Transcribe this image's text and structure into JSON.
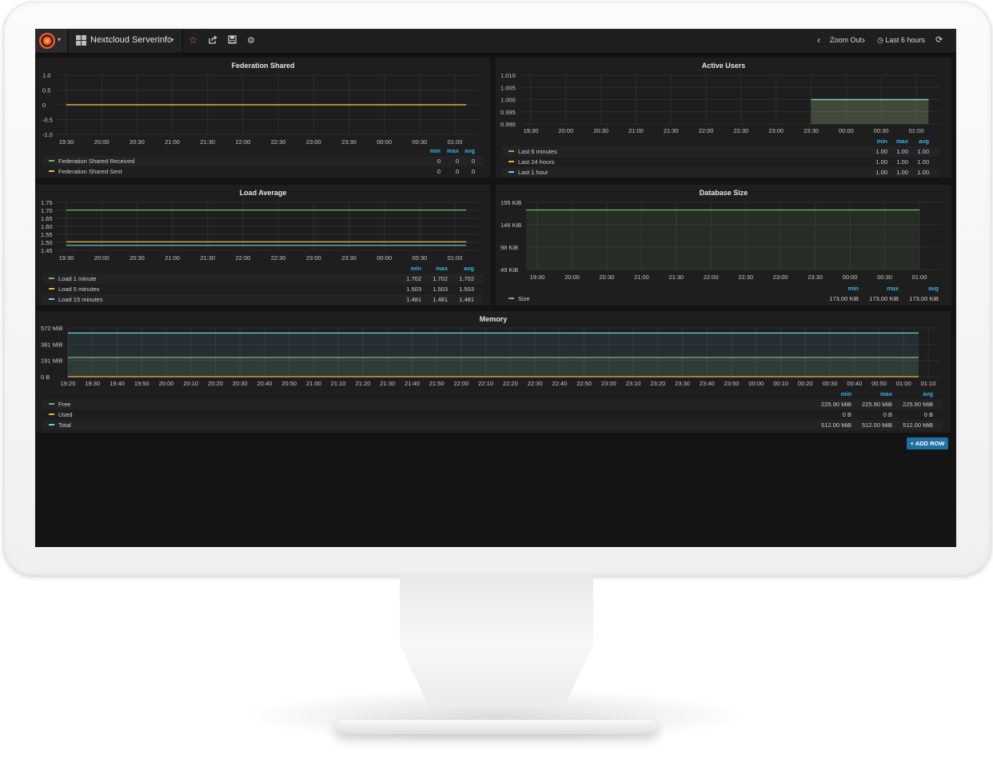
{
  "header": {
    "dashboard_title": "Nextcloud Serverinfo",
    "zoom_out": "Zoom Out",
    "time_range": "Last 6 hours",
    "icons": [
      "grafana-logo-icon",
      "dashboard-grid-icon",
      "star-icon",
      "share-icon",
      "save-icon",
      "gear-icon",
      "chevron-left-icon",
      "chevron-right-icon",
      "clock-icon",
      "refresh-icon"
    ]
  },
  "legend_columns": {
    "min": "min",
    "max": "max",
    "avg": "avg"
  },
  "add_row_label": "+ ADD ROW",
  "colors": {
    "green": "#7eb26d",
    "yellow": "#eab839",
    "cyan": "#6ed0e0",
    "accent": "#33b5e5",
    "button": "#1e6fa2"
  },
  "panels": {
    "federation": {
      "title": "Federation Shared",
      "series": [
        {
          "name": "Federation Shared Received",
          "min": "0",
          "max": "0",
          "avg": "0"
        },
        {
          "name": "Federation Shared Sent",
          "min": "0",
          "max": "0",
          "avg": "0"
        }
      ]
    },
    "active_users": {
      "title": "Active Users",
      "series": [
        {
          "name": "Last 5 minutes",
          "min": "1.00",
          "max": "1.00",
          "avg": "1.00"
        },
        {
          "name": "Last 24 hours",
          "min": "1.00",
          "max": "1.00",
          "avg": "1.00"
        },
        {
          "name": "Last 1 hour",
          "min": "1.00",
          "max": "1.00",
          "avg": "1.00"
        }
      ]
    },
    "load_average": {
      "title": "Load Average",
      "series": [
        {
          "name": "Load 1 minute",
          "min": "1.702",
          "max": "1.702",
          "avg": "1.702"
        },
        {
          "name": "Load 5 minutes",
          "min": "1.503",
          "max": "1.503",
          "avg": "1.503"
        },
        {
          "name": "Load 15 minutes",
          "min": "1.481",
          "max": "1.481",
          "avg": "1.481"
        }
      ]
    },
    "database_size": {
      "title": "Database Size",
      "series": [
        {
          "name": "Size",
          "min": "173.00 KiB",
          "max": "173.00 KiB",
          "avg": "173.00 KiB"
        }
      ]
    },
    "memory": {
      "title": "Memory",
      "series": [
        {
          "name": "Free",
          "min": "225.90 MiB",
          "max": "225.90 MiB",
          "avg": "225.90 MiB"
        },
        {
          "name": "Used",
          "min": "0 B",
          "max": "0 B",
          "avg": "0 B"
        },
        {
          "name": "Total",
          "min": "512.00 MiB",
          "max": "512.00 MiB",
          "avg": "512.00 MiB"
        }
      ]
    }
  },
  "chart_data": [
    {
      "id": "federation",
      "type": "line",
      "title": "Federation Shared",
      "x": [
        "19:30",
        "20:00",
        "20:30",
        "21:00",
        "21:30",
        "22:00",
        "22:30",
        "23:00",
        "23:30",
        "00:00",
        "00:30",
        "01:00"
      ],
      "yticks": [
        "1.0",
        "0.5",
        "0",
        "-0.5",
        "-1.0"
      ],
      "ylim": [
        -1.0,
        1.0
      ],
      "series": [
        {
          "name": "Federation Shared Received",
          "color": "#7eb26d",
          "values": [
            0,
            0,
            0,
            0,
            0,
            0,
            0,
            0,
            0,
            0,
            0,
            0
          ]
        },
        {
          "name": "Federation Shared Sent",
          "color": "#eab839",
          "values": [
            0,
            0,
            0,
            0,
            0,
            0,
            0,
            0,
            0,
            0,
            0,
            0
          ]
        }
      ]
    },
    {
      "id": "active_users",
      "type": "area",
      "title": "Active Users",
      "x": [
        "19:30",
        "20:00",
        "20:30",
        "21:00",
        "21:30",
        "22:00",
        "22:30",
        "23:00",
        "23:30",
        "00:00",
        "00:30",
        "01:00"
      ],
      "yticks": [
        "1.010",
        "1.005",
        "1.000",
        "0.995",
        "0.990"
      ],
      "ylim": [
        0.99,
        1.01
      ],
      "series": [
        {
          "name": "Last 5 minutes",
          "color": "#7eb26d",
          "x_range": [
            "23:30",
            "01:10"
          ],
          "value": 1.0
        },
        {
          "name": "Last 24 hours",
          "color": "#eab839",
          "x_range": [
            "23:30",
            "01:10"
          ],
          "value": 1.0
        },
        {
          "name": "Last 1 hour",
          "color": "#6ed0e0",
          "x_range": [
            "23:30",
            "01:10"
          ],
          "value": 1.0
        }
      ]
    },
    {
      "id": "load_average",
      "type": "line",
      "title": "Load Average",
      "x": [
        "19:30",
        "20:00",
        "20:30",
        "21:00",
        "21:30",
        "22:00",
        "22:30",
        "23:00",
        "23:30",
        "00:00",
        "00:30",
        "01:00"
      ],
      "yticks": [
        "1.75",
        "1.70",
        "1.65",
        "1.60",
        "1.55",
        "1.50",
        "1.45"
      ],
      "ylim": [
        1.45,
        1.75
      ],
      "series": [
        {
          "name": "Load 1 minute",
          "color": "#7eb26d",
          "value": 1.702
        },
        {
          "name": "Load 5 minutes",
          "color": "#eab839",
          "value": 1.503
        },
        {
          "name": "Load 15 minutes",
          "color": "#6ed0e0",
          "value": 1.481
        }
      ]
    },
    {
      "id": "database_size",
      "type": "area",
      "title": "Database Size",
      "x": [
        "19:30",
        "20:00",
        "20:30",
        "21:00",
        "21:30",
        "22:00",
        "22:30",
        "23:00",
        "23:30",
        "00:00",
        "00:30",
        "01:00"
      ],
      "yticks": [
        "195 KiB",
        "146 KiB",
        "98 KiB",
        "49 KiB"
      ],
      "ylim": [
        0,
        195
      ],
      "series": [
        {
          "name": "Size",
          "color": "#7eb26d",
          "value": 173
        }
      ]
    },
    {
      "id": "memory",
      "type": "area",
      "title": "Memory",
      "x": [
        "19:20",
        "19:30",
        "19:40",
        "19:50",
        "20:00",
        "20:10",
        "20:20",
        "20:30",
        "20:40",
        "20:50",
        "21:00",
        "21:10",
        "21:20",
        "21:30",
        "21:40",
        "21:50",
        "22:00",
        "22:10",
        "22:20",
        "22:30",
        "22:40",
        "22:50",
        "23:00",
        "23:10",
        "23:20",
        "23:30",
        "23:40",
        "23:50",
        "00:00",
        "00:10",
        "00:20",
        "00:30",
        "00:40",
        "00:50",
        "01:00",
        "01:10"
      ],
      "yticks": [
        "572 MiB",
        "381 MiB",
        "191 MiB",
        "0 B"
      ],
      "ylim": [
        0,
        572
      ],
      "series": [
        {
          "name": "Free",
          "color": "#7eb26d",
          "value": 225.9
        },
        {
          "name": "Used",
          "color": "#eab839",
          "value": 0
        },
        {
          "name": "Total",
          "color": "#6ed0e0",
          "value": 512
        }
      ]
    }
  ]
}
